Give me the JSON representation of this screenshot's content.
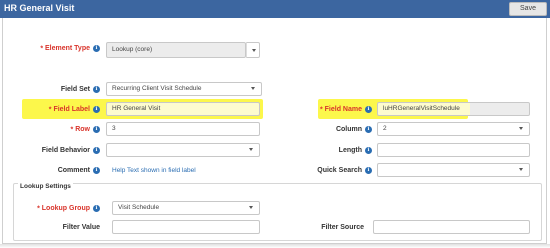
{
  "window": {
    "title": "HR General Visit",
    "save_label": "Save"
  },
  "form": {
    "element_type": {
      "label": "Element Type",
      "value": "Lookup (core)"
    },
    "field_set": {
      "label": "Field Set",
      "value": "Recurring Client Visit Schedule"
    },
    "field_label": {
      "label": "Field Label",
      "value": "HR General Visit"
    },
    "field_name": {
      "label": "Field Name",
      "value": "luHRGeneralVisitSchedule"
    },
    "row": {
      "label": "Row",
      "value": "3"
    },
    "column": {
      "label": "Column",
      "value": "2"
    },
    "field_behavior": {
      "label": "Field Behavior",
      "value": ""
    },
    "length": {
      "label": "Length",
      "value": ""
    },
    "comment": {
      "label": "Comment",
      "value": "Help Text shown in field label"
    },
    "quick_search": {
      "label": "Quick Search",
      "value": ""
    }
  },
  "lookup_settings": {
    "title": "Lookup Settings",
    "lookup_group": {
      "label": "Lookup Group",
      "value": "Visit Schedule"
    },
    "filter_value": {
      "label": "Filter Value",
      "value": ""
    },
    "filter_source": {
      "label": "Filter Source",
      "value": ""
    }
  },
  "colors": {
    "title_bar": "#3c66a0",
    "required": "#d9342b",
    "info_icon": "#2a6db2",
    "highlight": "#fbf62c"
  }
}
